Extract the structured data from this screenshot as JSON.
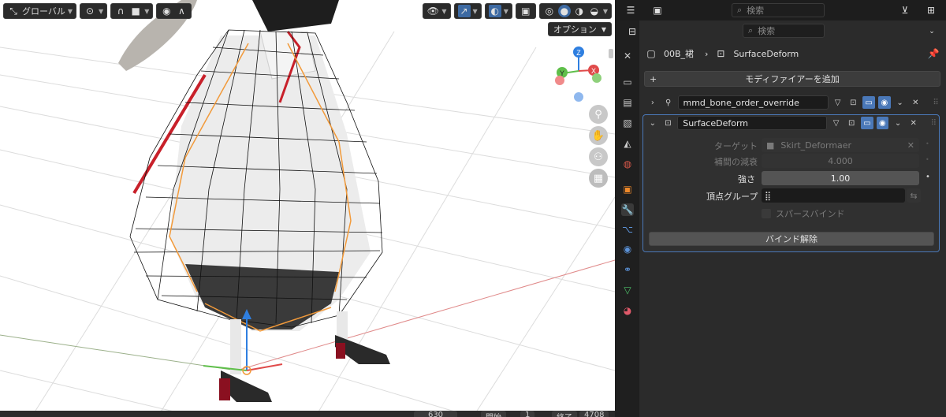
{
  "viewport": {
    "orientation_label": "グローバル",
    "options_label": "オプション",
    "gizmo": {
      "x": "X",
      "y": "Y",
      "z": "Z"
    },
    "footer": {
      "frame_current": "630",
      "start_label": "開始",
      "start_value": "1",
      "end_label": "終了",
      "end_value": "4708"
    }
  },
  "header": {
    "search1_placeholder": "検索",
    "search2_placeholder": "検索"
  },
  "breadcrumb": {
    "object": "00B_裙",
    "modifier": "SurfaceDeform"
  },
  "add_modifier_label": "モディファイアーを追加",
  "modifiers": [
    {
      "name": "mmd_bone_order_override",
      "expanded": false
    },
    {
      "name": "SurfaceDeform",
      "expanded": true
    }
  ],
  "surface_deform": {
    "target_label": "ターゲット",
    "target_value": "Skirt_Deformaer",
    "falloff_label": "補間の減衰",
    "falloff_value": "4.000",
    "strength_label": "強さ",
    "strength_value": "1.00",
    "vertex_group_label": "頂点グループ",
    "vertex_group_value": "",
    "sparse_bind_label": "スパースバインド",
    "unbind_label": "バインド解除"
  },
  "colors": {
    "accent": "#4a78b8",
    "panel": "#2b2b2b",
    "viewport_bg": "#ffffff"
  }
}
